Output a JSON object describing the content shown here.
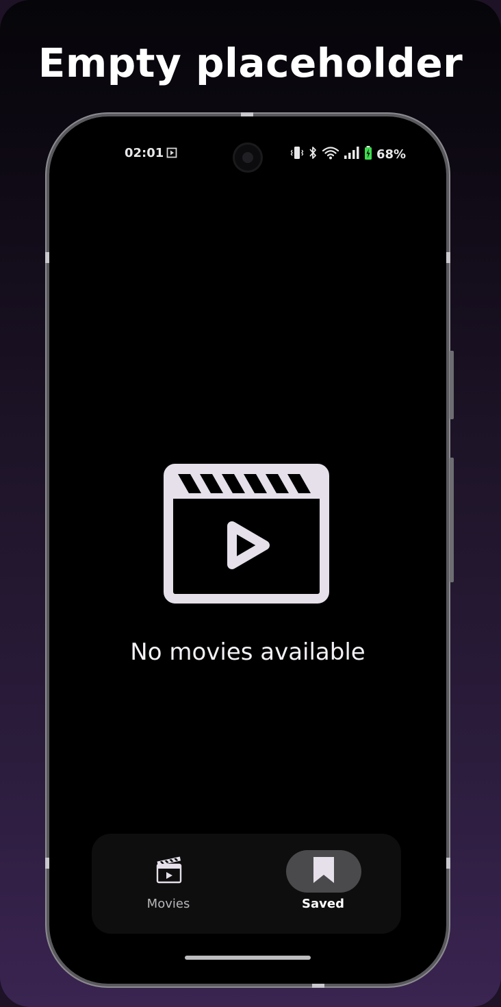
{
  "headline": "Empty placeholder",
  "status_bar": {
    "time": "02:01",
    "battery_percent": "68%",
    "icons": [
      "media-icon",
      "vibrate-icon",
      "bluetooth-icon",
      "wifi-icon",
      "signal-icon",
      "battery-charging-icon"
    ]
  },
  "empty_state": {
    "icon": "clapperboard-play-icon",
    "message": "No movies available"
  },
  "bottom_nav": {
    "items": [
      {
        "label": "Movies",
        "icon": "clapperboard-icon",
        "selected": false
      },
      {
        "label": "Saved",
        "icon": "bookmark-icon",
        "selected": true
      }
    ]
  },
  "colors": {
    "screen_background": "#000000",
    "icon_fill": "#e6e0ea",
    "nav_selected_pill": "#4a4a4c",
    "gradient_bottom": "#3a2451"
  }
}
